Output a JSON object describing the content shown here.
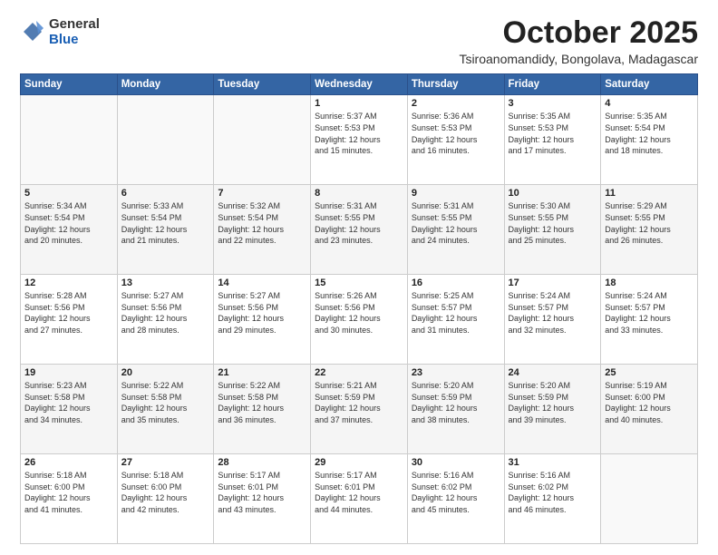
{
  "logo": {
    "general": "General",
    "blue": "Blue"
  },
  "header": {
    "month": "October 2025",
    "location": "Tsiroanomandidy, Bongolava, Madagascar"
  },
  "days_of_week": [
    "Sunday",
    "Monday",
    "Tuesday",
    "Wednesday",
    "Thursday",
    "Friday",
    "Saturday"
  ],
  "weeks": [
    [
      {
        "day": "",
        "info": ""
      },
      {
        "day": "",
        "info": ""
      },
      {
        "day": "",
        "info": ""
      },
      {
        "day": "1",
        "info": "Sunrise: 5:37 AM\nSunset: 5:53 PM\nDaylight: 12 hours\nand 15 minutes."
      },
      {
        "day": "2",
        "info": "Sunrise: 5:36 AM\nSunset: 5:53 PM\nDaylight: 12 hours\nand 16 minutes."
      },
      {
        "day": "3",
        "info": "Sunrise: 5:35 AM\nSunset: 5:53 PM\nDaylight: 12 hours\nand 17 minutes."
      },
      {
        "day": "4",
        "info": "Sunrise: 5:35 AM\nSunset: 5:54 PM\nDaylight: 12 hours\nand 18 minutes."
      }
    ],
    [
      {
        "day": "5",
        "info": "Sunrise: 5:34 AM\nSunset: 5:54 PM\nDaylight: 12 hours\nand 20 minutes."
      },
      {
        "day": "6",
        "info": "Sunrise: 5:33 AM\nSunset: 5:54 PM\nDaylight: 12 hours\nand 21 minutes."
      },
      {
        "day": "7",
        "info": "Sunrise: 5:32 AM\nSunset: 5:54 PM\nDaylight: 12 hours\nand 22 minutes."
      },
      {
        "day": "8",
        "info": "Sunrise: 5:31 AM\nSunset: 5:55 PM\nDaylight: 12 hours\nand 23 minutes."
      },
      {
        "day": "9",
        "info": "Sunrise: 5:31 AM\nSunset: 5:55 PM\nDaylight: 12 hours\nand 24 minutes."
      },
      {
        "day": "10",
        "info": "Sunrise: 5:30 AM\nSunset: 5:55 PM\nDaylight: 12 hours\nand 25 minutes."
      },
      {
        "day": "11",
        "info": "Sunrise: 5:29 AM\nSunset: 5:55 PM\nDaylight: 12 hours\nand 26 minutes."
      }
    ],
    [
      {
        "day": "12",
        "info": "Sunrise: 5:28 AM\nSunset: 5:56 PM\nDaylight: 12 hours\nand 27 minutes."
      },
      {
        "day": "13",
        "info": "Sunrise: 5:27 AM\nSunset: 5:56 PM\nDaylight: 12 hours\nand 28 minutes."
      },
      {
        "day": "14",
        "info": "Sunrise: 5:27 AM\nSunset: 5:56 PM\nDaylight: 12 hours\nand 29 minutes."
      },
      {
        "day": "15",
        "info": "Sunrise: 5:26 AM\nSunset: 5:56 PM\nDaylight: 12 hours\nand 30 minutes."
      },
      {
        "day": "16",
        "info": "Sunrise: 5:25 AM\nSunset: 5:57 PM\nDaylight: 12 hours\nand 31 minutes."
      },
      {
        "day": "17",
        "info": "Sunrise: 5:24 AM\nSunset: 5:57 PM\nDaylight: 12 hours\nand 32 minutes."
      },
      {
        "day": "18",
        "info": "Sunrise: 5:24 AM\nSunset: 5:57 PM\nDaylight: 12 hours\nand 33 minutes."
      }
    ],
    [
      {
        "day": "19",
        "info": "Sunrise: 5:23 AM\nSunset: 5:58 PM\nDaylight: 12 hours\nand 34 minutes."
      },
      {
        "day": "20",
        "info": "Sunrise: 5:22 AM\nSunset: 5:58 PM\nDaylight: 12 hours\nand 35 minutes."
      },
      {
        "day": "21",
        "info": "Sunrise: 5:22 AM\nSunset: 5:58 PM\nDaylight: 12 hours\nand 36 minutes."
      },
      {
        "day": "22",
        "info": "Sunrise: 5:21 AM\nSunset: 5:59 PM\nDaylight: 12 hours\nand 37 minutes."
      },
      {
        "day": "23",
        "info": "Sunrise: 5:20 AM\nSunset: 5:59 PM\nDaylight: 12 hours\nand 38 minutes."
      },
      {
        "day": "24",
        "info": "Sunrise: 5:20 AM\nSunset: 5:59 PM\nDaylight: 12 hours\nand 39 minutes."
      },
      {
        "day": "25",
        "info": "Sunrise: 5:19 AM\nSunset: 6:00 PM\nDaylight: 12 hours\nand 40 minutes."
      }
    ],
    [
      {
        "day": "26",
        "info": "Sunrise: 5:18 AM\nSunset: 6:00 PM\nDaylight: 12 hours\nand 41 minutes."
      },
      {
        "day": "27",
        "info": "Sunrise: 5:18 AM\nSunset: 6:00 PM\nDaylight: 12 hours\nand 42 minutes."
      },
      {
        "day": "28",
        "info": "Sunrise: 5:17 AM\nSunset: 6:01 PM\nDaylight: 12 hours\nand 43 minutes."
      },
      {
        "day": "29",
        "info": "Sunrise: 5:17 AM\nSunset: 6:01 PM\nDaylight: 12 hours\nand 44 minutes."
      },
      {
        "day": "30",
        "info": "Sunrise: 5:16 AM\nSunset: 6:02 PM\nDaylight: 12 hours\nand 45 minutes."
      },
      {
        "day": "31",
        "info": "Sunrise: 5:16 AM\nSunset: 6:02 PM\nDaylight: 12 hours\nand 46 minutes."
      },
      {
        "day": "",
        "info": ""
      }
    ]
  ]
}
